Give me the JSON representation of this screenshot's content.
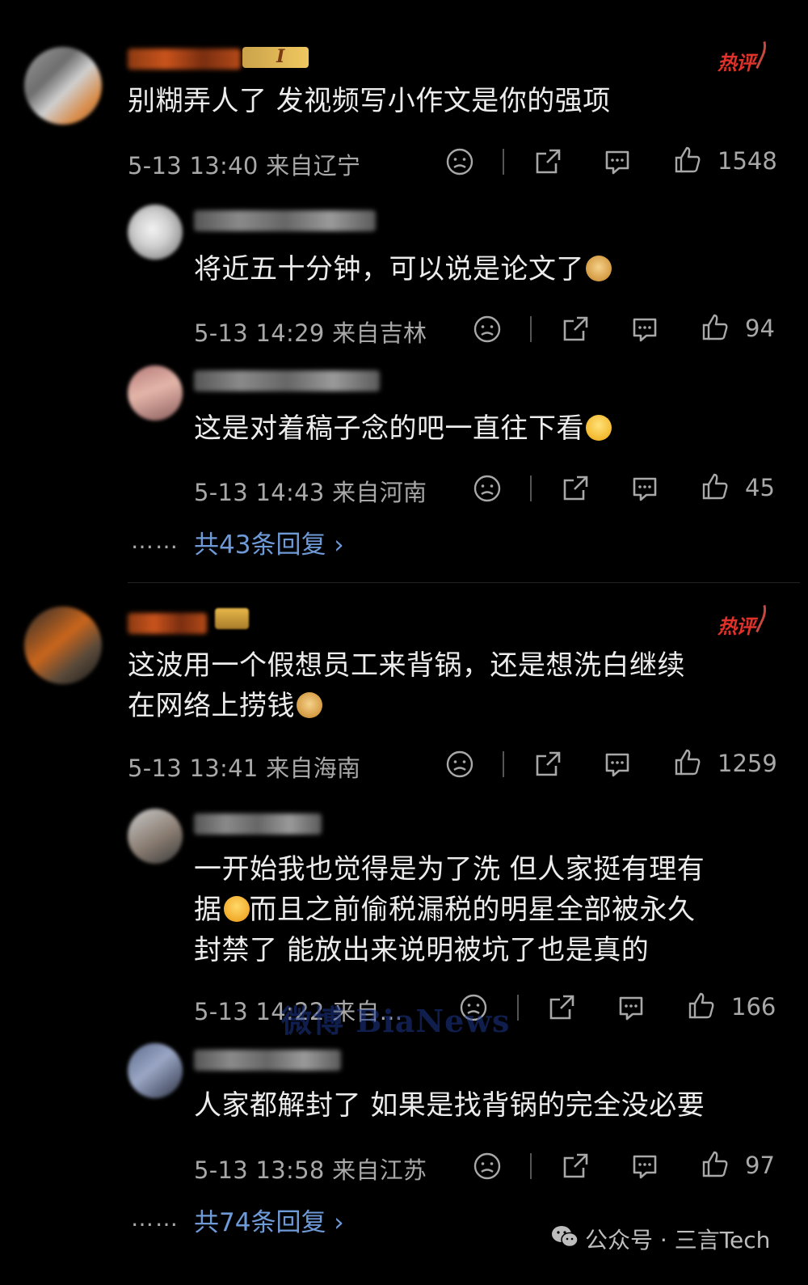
{
  "hot_label": "热评",
  "comments": [
    {
      "text": "别糊弄人了 发视频写小作文是你的强项",
      "meta": "5-13 13:40  来自辽宁",
      "likes": "1548",
      "badge_level": "I",
      "replies": [
        {
          "text": "将近五十分钟，可以说是论文了",
          "meta": "5-13 14:29  来自吉林",
          "likes": "94"
        },
        {
          "text": "这是对着稿子念的吧一直往下看",
          "meta": "5-13 14:43  来自河南",
          "likes": "45"
        }
      ],
      "more_dots": "……",
      "more_replies": "共43条回复 ›"
    },
    {
      "text_line1": "这波用一个假想员工来背锅，还是想洗白继续",
      "text_line2": "在网络上捞钱",
      "meta": "5-13 13:41  来自海南",
      "likes": "1259",
      "replies": [
        {
          "text_line1": "一开始我也觉得是为了洗 但人家挺有理有",
          "text_line2a": "据",
          "text_line2b": "而且之前偷税漏税的明星全部被永久",
          "text_line3": "封禁了 能放出来说明被坑了也是真的",
          "meta": "5-13 14:22  来自...",
          "likes": "166"
        },
        {
          "text": "人家都解封了 如果是找背锅的完全没必要",
          "meta": "5-13 13:58  来自江苏",
          "likes": "97"
        }
      ],
      "more_dots": "……",
      "more_replies": "共74条回复 ›"
    }
  ],
  "watermark": "微博 BiaNews",
  "footer": "公众号 · 三言Tech",
  "icons": [
    "dislike-icon",
    "share-icon",
    "comment-icon",
    "like-icon"
  ]
}
